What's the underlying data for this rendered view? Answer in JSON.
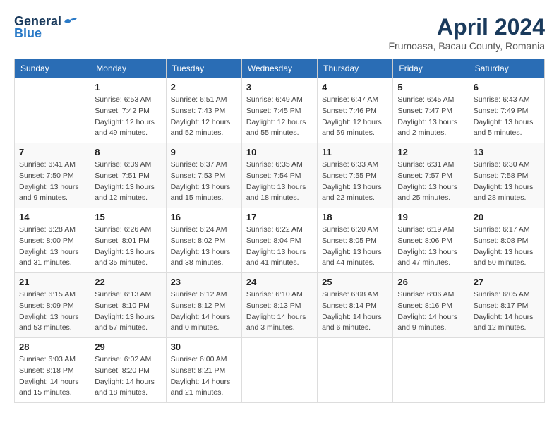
{
  "logo": {
    "general": "General",
    "blue": "Blue"
  },
  "title": "April 2024",
  "location": "Frumoasa, Bacau County, Romania",
  "weekdays": [
    "Sunday",
    "Monday",
    "Tuesday",
    "Wednesday",
    "Thursday",
    "Friday",
    "Saturday"
  ],
  "weeks": [
    [
      null,
      {
        "day": 1,
        "sunrise": "6:53 AM",
        "sunset": "7:42 PM",
        "daylight": "12 hours and 49 minutes."
      },
      {
        "day": 2,
        "sunrise": "6:51 AM",
        "sunset": "7:43 PM",
        "daylight": "12 hours and 52 minutes."
      },
      {
        "day": 3,
        "sunrise": "6:49 AM",
        "sunset": "7:45 PM",
        "daylight": "12 hours and 55 minutes."
      },
      {
        "day": 4,
        "sunrise": "6:47 AM",
        "sunset": "7:46 PM",
        "daylight": "12 hours and 59 minutes."
      },
      {
        "day": 5,
        "sunrise": "6:45 AM",
        "sunset": "7:47 PM",
        "daylight": "13 hours and 2 minutes."
      },
      {
        "day": 6,
        "sunrise": "6:43 AM",
        "sunset": "7:49 PM",
        "daylight": "13 hours and 5 minutes."
      }
    ],
    [
      {
        "day": 7,
        "sunrise": "6:41 AM",
        "sunset": "7:50 PM",
        "daylight": "13 hours and 9 minutes."
      },
      {
        "day": 8,
        "sunrise": "6:39 AM",
        "sunset": "7:51 PM",
        "daylight": "13 hours and 12 minutes."
      },
      {
        "day": 9,
        "sunrise": "6:37 AM",
        "sunset": "7:53 PM",
        "daylight": "13 hours and 15 minutes."
      },
      {
        "day": 10,
        "sunrise": "6:35 AM",
        "sunset": "7:54 PM",
        "daylight": "13 hours and 18 minutes."
      },
      {
        "day": 11,
        "sunrise": "6:33 AM",
        "sunset": "7:55 PM",
        "daylight": "13 hours and 22 minutes."
      },
      {
        "day": 12,
        "sunrise": "6:31 AM",
        "sunset": "7:57 PM",
        "daylight": "13 hours and 25 minutes."
      },
      {
        "day": 13,
        "sunrise": "6:30 AM",
        "sunset": "7:58 PM",
        "daylight": "13 hours and 28 minutes."
      }
    ],
    [
      {
        "day": 14,
        "sunrise": "6:28 AM",
        "sunset": "8:00 PM",
        "daylight": "13 hours and 31 minutes."
      },
      {
        "day": 15,
        "sunrise": "6:26 AM",
        "sunset": "8:01 PM",
        "daylight": "13 hours and 35 minutes."
      },
      {
        "day": 16,
        "sunrise": "6:24 AM",
        "sunset": "8:02 PM",
        "daylight": "13 hours and 38 minutes."
      },
      {
        "day": 17,
        "sunrise": "6:22 AM",
        "sunset": "8:04 PM",
        "daylight": "13 hours and 41 minutes."
      },
      {
        "day": 18,
        "sunrise": "6:20 AM",
        "sunset": "8:05 PM",
        "daylight": "13 hours and 44 minutes."
      },
      {
        "day": 19,
        "sunrise": "6:19 AM",
        "sunset": "8:06 PM",
        "daylight": "13 hours and 47 minutes."
      },
      {
        "day": 20,
        "sunrise": "6:17 AM",
        "sunset": "8:08 PM",
        "daylight": "13 hours and 50 minutes."
      }
    ],
    [
      {
        "day": 21,
        "sunrise": "6:15 AM",
        "sunset": "8:09 PM",
        "daylight": "13 hours and 53 minutes."
      },
      {
        "day": 22,
        "sunrise": "6:13 AM",
        "sunset": "8:10 PM",
        "daylight": "13 hours and 57 minutes."
      },
      {
        "day": 23,
        "sunrise": "6:12 AM",
        "sunset": "8:12 PM",
        "daylight": "14 hours and 0 minutes."
      },
      {
        "day": 24,
        "sunrise": "6:10 AM",
        "sunset": "8:13 PM",
        "daylight": "14 hours and 3 minutes."
      },
      {
        "day": 25,
        "sunrise": "6:08 AM",
        "sunset": "8:14 PM",
        "daylight": "14 hours and 6 minutes."
      },
      {
        "day": 26,
        "sunrise": "6:06 AM",
        "sunset": "8:16 PM",
        "daylight": "14 hours and 9 minutes."
      },
      {
        "day": 27,
        "sunrise": "6:05 AM",
        "sunset": "8:17 PM",
        "daylight": "14 hours and 12 minutes."
      }
    ],
    [
      {
        "day": 28,
        "sunrise": "6:03 AM",
        "sunset": "8:18 PM",
        "daylight": "14 hours and 15 minutes."
      },
      {
        "day": 29,
        "sunrise": "6:02 AM",
        "sunset": "8:20 PM",
        "daylight": "14 hours and 18 minutes."
      },
      {
        "day": 30,
        "sunrise": "6:00 AM",
        "sunset": "8:21 PM",
        "daylight": "14 hours and 21 minutes."
      },
      null,
      null,
      null,
      null
    ]
  ]
}
